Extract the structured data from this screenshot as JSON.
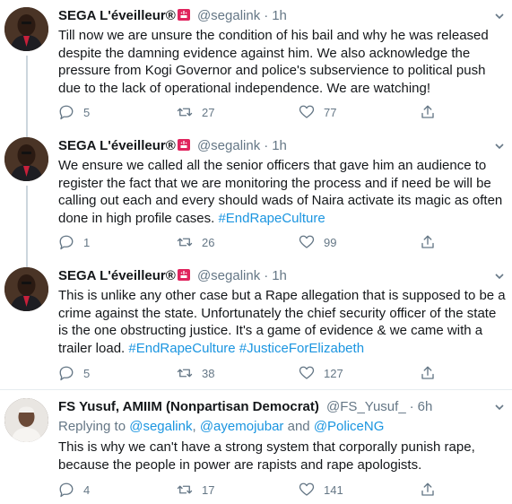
{
  "tweets": [
    {
      "name": "SEGA L'éveilleur®",
      "handle": "@segalink",
      "time": "1h",
      "text_parts": [
        {
          "t": "Till now we are unsure the condition of his bail and why he was released despite the damning evidence against him. We also acknowledge the pressure from Kogi Governor and police's subservience to political push due to the lack of operational independence. We are watching!",
          "tag": false
        }
      ],
      "replies": "5",
      "retweets": "27",
      "likes": "77"
    },
    {
      "name": "SEGA L'éveilleur®",
      "handle": "@segalink",
      "time": "1h",
      "text_parts": [
        {
          "t": "We ensure we called all the senior officers that gave him an audience to register the fact that we are monitoring the process and if need be will be calling out each and every should wads of Naira activate its magic as often done in high profile cases. ",
          "tag": false
        },
        {
          "t": "#EndRapeCulture",
          "tag": true
        }
      ],
      "replies": "1",
      "retweets": "26",
      "likes": "99"
    },
    {
      "name": "SEGA L'éveilleur®",
      "handle": "@segalink",
      "time": "1h",
      "text_parts": [
        {
          "t": "This is unlike any other case but a Rape allegation that is supposed to be a crime against the state. Unfortunately the chief security officer of the state is the one obstructing justice. It's a game of evidence & we came with a trailer load. ",
          "tag": false
        },
        {
          "t": "#EndRapeCulture",
          "tag": true
        },
        {
          "t": " ",
          "tag": false
        },
        {
          "t": "#JusticeForElizabeth",
          "tag": true
        }
      ],
      "replies": "5",
      "retweets": "38",
      "likes": "127"
    },
    {
      "name": "FS Yusuf, AMIIM (Nonpartisan Democrat)",
      "handle": "@FS_Yusuf_",
      "time": "6h",
      "reply_to_label": "Replying to ",
      "reply_to": [
        {
          "t": "@segalink",
          "tag": true
        },
        {
          "t": ", ",
          "tag": false
        },
        {
          "t": "@ayemojubar",
          "tag": true
        },
        {
          "t": " and ",
          "tag": false
        },
        {
          "t": "@PoliceNG",
          "tag": true
        }
      ],
      "text_parts": [
        {
          "t": "This is why we can't have a strong system that corporally punish rape, because the people in power are rapists and rape apologists.",
          "tag": false
        }
      ],
      "replies": "4",
      "retweets": "17",
      "likes": "141"
    }
  ],
  "colors": {
    "accent": "#1b95e0",
    "muted": "#657786",
    "text": "#14171a",
    "badge": "#e0245e",
    "thread_line": "#ccd6dd"
  },
  "icons": {
    "reply": "reply-icon",
    "retweet": "retweet-icon",
    "like": "heart-icon",
    "share": "share-icon",
    "more": "chevron-down-icon",
    "badge": "siren-badge-icon"
  }
}
